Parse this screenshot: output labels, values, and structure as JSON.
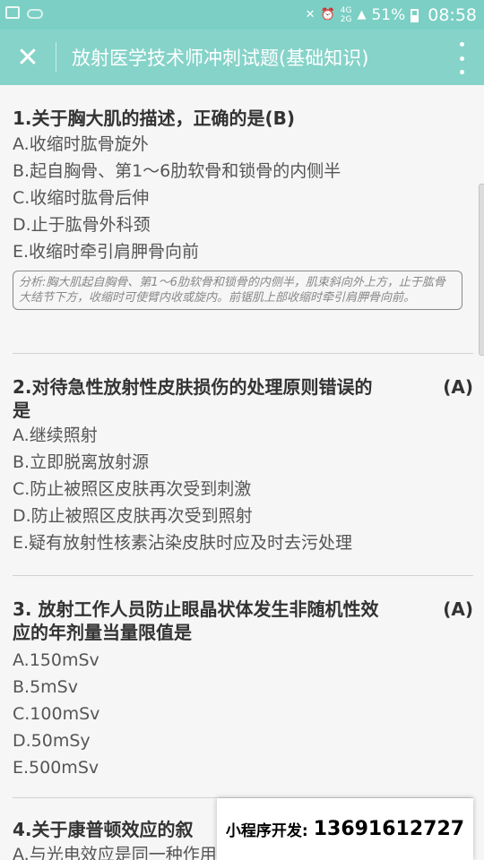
{
  "statusbar": {
    "battery": "51%",
    "time": "08:58",
    "net_top": "4G",
    "net_bottom": "2G"
  },
  "appbar": {
    "title": "放射医学技术师冲刺试题(基础知识)"
  },
  "questions": [
    {
      "title": "1.关于胸大肌的描述，正确的是(B)",
      "options": [
        "A.收缩时肱骨旋外",
        "B.起自胸骨、第1～6肋软骨和锁骨的内侧半",
        "C.收缩时肱骨后伸",
        "D.止于肱骨外科颈",
        "E.收缩时牵引肩胛骨向前"
      ],
      "analysis": "分析:胸大肌起自胸骨、第1～6肋软骨和锁骨的内侧半，肌束斜向外上方，止于肱骨大结节下方，收缩时可使臂内收或旋内。前锯肌上部收缩时牵引肩胛骨向前。"
    },
    {
      "title_line1": "2.对待急性放射性皮肤损伤的处理原则错误的",
      "title_line2": "是",
      "answer": "(A)",
      "options": [
        "A.继续照射",
        "B.立即脱离放射源",
        "C.防止被照区皮肤再次受到刺激",
        "D.防止被照区皮肤再次受到照射",
        "E.疑有放射性核素沾染皮肤时应及时去污处理"
      ]
    },
    {
      "title_line1": "3. 放射工作人员防止眼晶状体发生非随机性效",
      "title_line2": "应的年剂量当量限值是",
      "answer": "(A)",
      "options": [
        "A.150mSv",
        "B.5mSv",
        "C.100mSv",
        "D.50mSy",
        "E.500mSv"
      ]
    },
    {
      "title": "4.关于康普顿效应的叙",
      "partial_option": "A.与光电效应是同一种作用形式"
    }
  ],
  "promo": {
    "label": "小程序开发:",
    "phone": "13691612727"
  },
  "colors": {
    "statusbar": "#7bcfc4",
    "appbar": "#86d3c9"
  }
}
